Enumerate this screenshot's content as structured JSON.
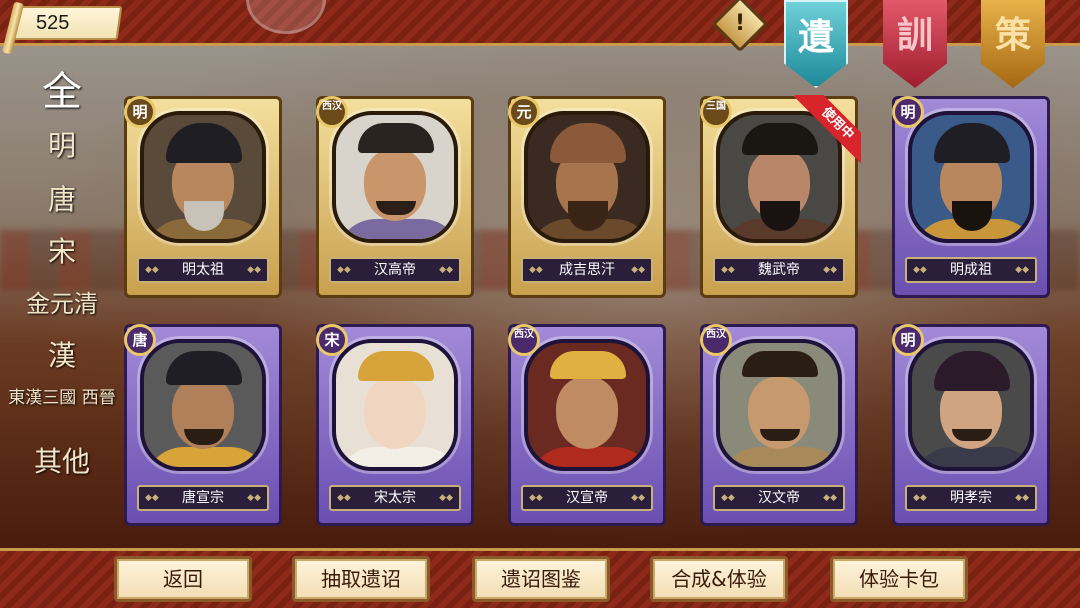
{
  "currency": {
    "value": "525"
  },
  "alert": {
    "symbol": "!"
  },
  "banners": [
    "遺",
    "訓",
    "策"
  ],
  "categories": [
    "全",
    "明",
    "唐",
    "宋",
    "金元清",
    "漢",
    "東漢三國 西晉",
    "其他"
  ],
  "in_use_label": "使用中",
  "cards": [
    {
      "era": "明",
      "name": "明太祖"
    },
    {
      "era": "西汉",
      "name": "汉高帝"
    },
    {
      "era": "元",
      "name": "成吉思汗"
    },
    {
      "era": "三国",
      "name": "魏武帝"
    },
    {
      "era": "明",
      "name": "明成祖"
    },
    {
      "era": "唐",
      "name": "唐宣宗"
    },
    {
      "era": "宋",
      "name": "宋太宗"
    },
    {
      "era": "西汉",
      "name": "汉宣帝"
    },
    {
      "era": "西汉",
      "name": "汉文帝"
    },
    {
      "era": "明",
      "name": "明孝宗"
    }
  ],
  "bottom_buttons": [
    "返回",
    "抽取遗诏",
    "遗诏图鉴",
    "合成&体验",
    "体验卡包"
  ]
}
